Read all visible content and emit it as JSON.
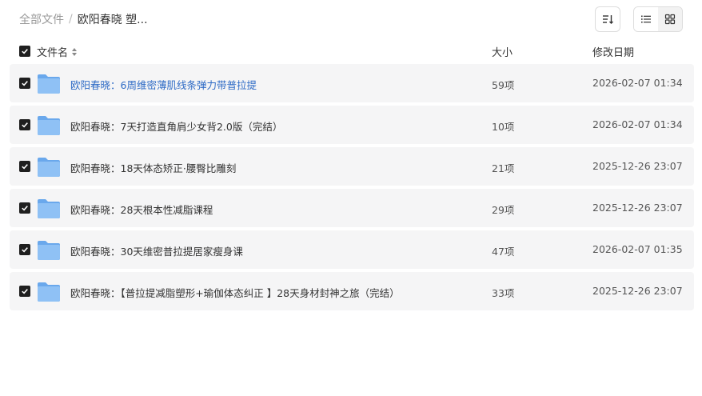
{
  "breadcrumb": {
    "root": "全部文件",
    "separator": "/",
    "current": "欧阳春晓 塑..."
  },
  "toolbar": {
    "sort_icon": "sort-icon",
    "list_view_icon": "list-view-icon",
    "grid_view_icon": "grid-view-icon",
    "active_view": "list"
  },
  "table": {
    "columns": {
      "name": "文件名",
      "size": "大小",
      "date": "修改日期"
    },
    "rows": [
      {
        "name": "欧阳春晓：6周维密薄肌线条弹力带普拉提",
        "size": "59项",
        "date": "2026-02-07 01:34",
        "checked": true,
        "highlight": true
      },
      {
        "name": "欧阳春晓：7天打造直角肩少女背2.0版（完结）",
        "size": "10项",
        "date": "2026-02-07 01:34",
        "checked": true,
        "highlight": false
      },
      {
        "name": "欧阳春晓：18天体态矫正·腰臀比雕刻",
        "size": "21项",
        "date": "2025-12-26 23:07",
        "checked": true,
        "highlight": false
      },
      {
        "name": "欧阳春晓：28天根本性减脂课程",
        "size": "29项",
        "date": "2025-12-26 23:07",
        "checked": true,
        "highlight": false
      },
      {
        "name": "欧阳春晓：30天维密普拉提居家瘦身课",
        "size": "47项",
        "date": "2026-02-07 01:35",
        "checked": true,
        "highlight": false
      },
      {
        "name": "欧阳春晓：【普拉提减脂塑形+瑜伽体态纠正 】28天身材封神之旅（完结）",
        "size": "33项",
        "date": "2025-12-26 23:07",
        "checked": true,
        "highlight": false
      }
    ]
  },
  "colors": {
    "row_bg": "#f5f5f6",
    "link": "#2d6ac5",
    "checkbox": "#1f1f1f",
    "folder": "#7fb6f2"
  }
}
